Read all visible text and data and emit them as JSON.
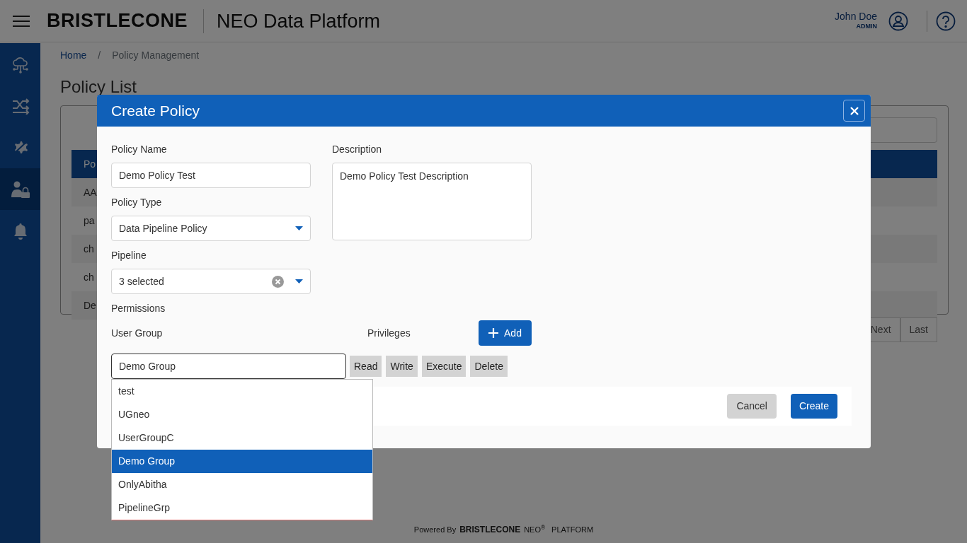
{
  "header": {
    "brand": "BRISTLECONE",
    "product": "NEO Data Platform",
    "user_name": "John Doe",
    "user_role": "ADMIN"
  },
  "sidebar": {
    "items": [
      {
        "kind": "cloud",
        "selected": false
      },
      {
        "kind": "shuffle",
        "selected": false
      },
      {
        "kind": "gear",
        "selected": false
      },
      {
        "kind": "user-lock",
        "selected": true
      },
      {
        "kind": "bell",
        "selected": false
      }
    ]
  },
  "breadcrumb": [
    {
      "label": "Home",
      "link": true
    },
    {
      "label": "Policy Management",
      "link": false
    }
  ],
  "breadcrumb_separator": "/",
  "page_title": "Policy List",
  "table": {
    "columns": [
      "Po"
    ],
    "rows": [
      "AA",
      "pa",
      "ch",
      "ch",
      "De"
    ]
  },
  "pagination": [
    "Next",
    "Last"
  ],
  "modal": {
    "title": "Create Policy",
    "policy_name": {
      "label": "Policy Name",
      "value": "Demo Policy Test"
    },
    "policy_type": {
      "label": "Policy Type",
      "value": "Data Pipeline Policy"
    },
    "pipeline": {
      "label": "Pipeline",
      "value": "3 selected"
    },
    "description": {
      "label": "Description",
      "value": "Demo Policy Test Description"
    },
    "permissions_label": "Permissions",
    "user_group_label": "User Group",
    "privileges_label": "Privileges",
    "add_button": "Add",
    "user_group": {
      "value": "Demo Group"
    },
    "privileges": [
      "Read",
      "Write",
      "Execute",
      "Delete"
    ],
    "options": [
      {
        "label": "test",
        "selected": false
      },
      {
        "label": "UGneo",
        "selected": false
      },
      {
        "label": "UserGroupC",
        "selected": false
      },
      {
        "label": "Demo Group",
        "selected": true
      },
      {
        "label": "OnlyAbitha",
        "selected": false
      },
      {
        "label": "PipelineGrp",
        "selected": false
      }
    ],
    "buttons": [
      {
        "label": "Cancel",
        "kind": "secondary"
      },
      {
        "label": "Create",
        "kind": "primary"
      }
    ]
  },
  "footer": {
    "powered_by": "Powered By",
    "brand": "BRISTLECONE",
    "product": "NEO$^{®}$",
    "platform": "PLATFORM"
  }
}
